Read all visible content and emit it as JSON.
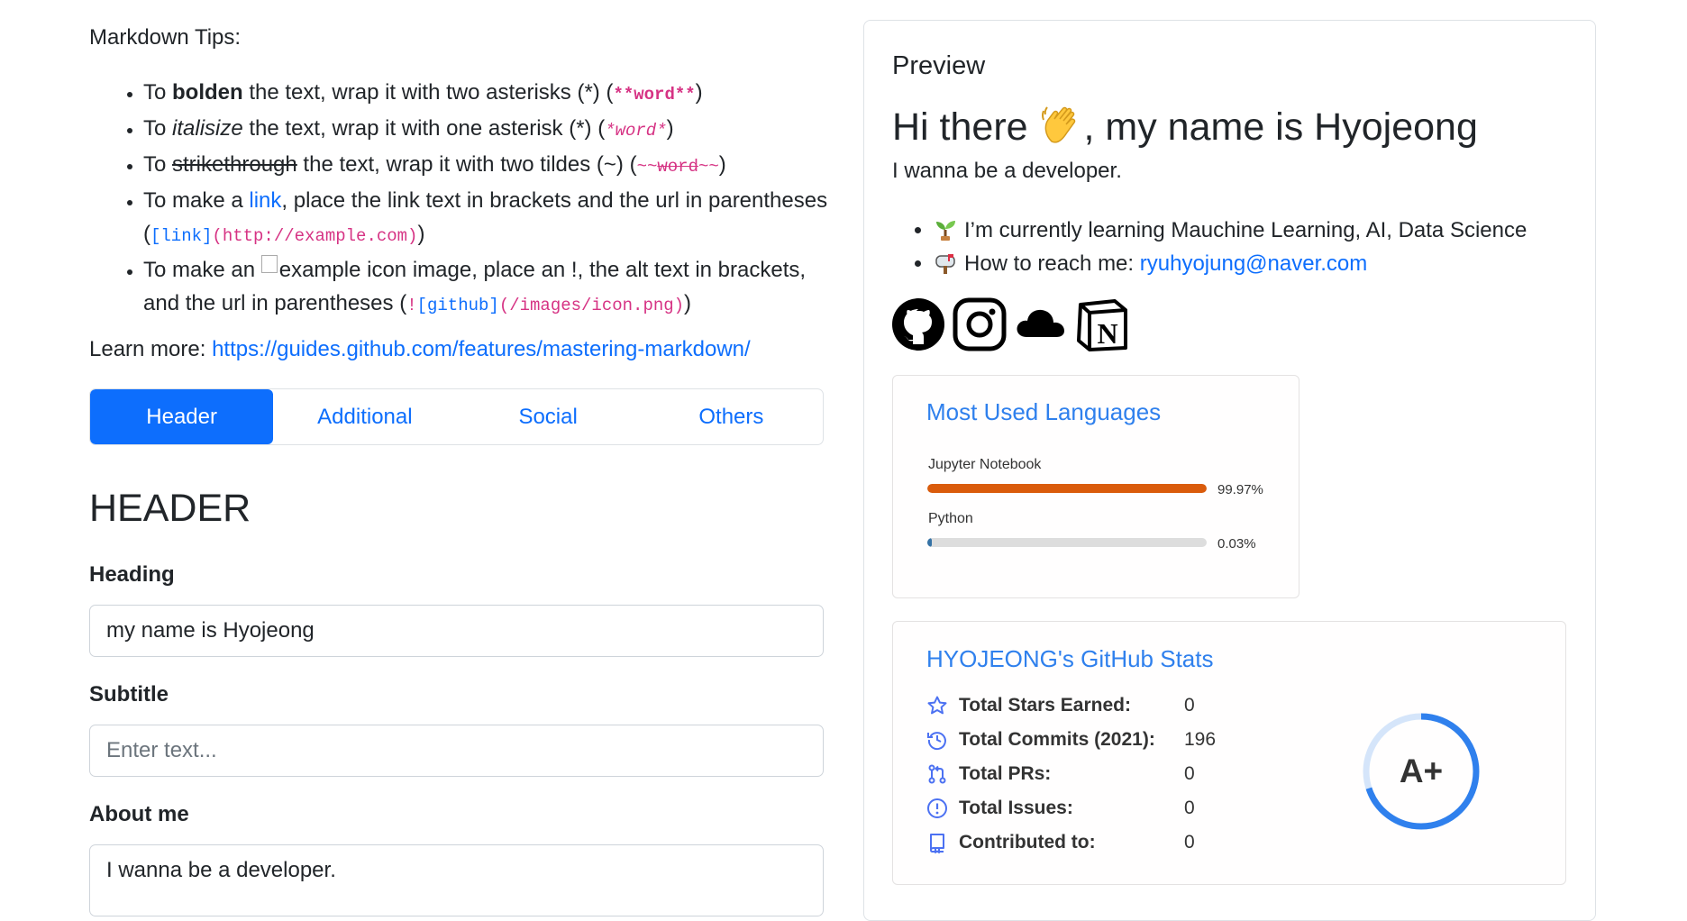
{
  "tips": {
    "title": "Markdown Tips:",
    "bold": {
      "pre": "To ",
      "word": "bolden",
      "post": " the text, wrap it with two asterisks (*) (",
      "code": "**word**",
      "end": ")"
    },
    "italic": {
      "pre": "To ",
      "word": "italisize",
      "post": " the text, wrap it with one asterisk (*) (",
      "code": "*word*",
      "end": ")"
    },
    "strike": {
      "pre": "To ",
      "word": "strikethrough",
      "post": " the text, wrap it with two tildes (~) (",
      "code_a": "~~",
      "code_b": "word",
      "code_c": "~~",
      "end": ")"
    },
    "link": {
      "pre": "To make a ",
      "word": "link",
      "post": ", place the link text in brackets and the url in parentheses (",
      "code_a": "[link]",
      "code_b": "(http://example.com)",
      "end": ")"
    },
    "image": {
      "pre": "To make an ",
      "alt": "example icon",
      "post": " image, place an !, the alt text in brackets, and the url in parentheses (",
      "code_a": "!",
      "code_b": "[github]",
      "code_c": "(/images/icon.png)",
      "end": ")"
    },
    "learn_label": "Learn more: ",
    "learn_url": "https://guides.github.com/features/mastering-markdown/"
  },
  "tabs": [
    {
      "label": "Header",
      "active": true
    },
    {
      "label": "Additional",
      "active": false
    },
    {
      "label": "Social",
      "active": false
    },
    {
      "label": "Others",
      "active": false
    }
  ],
  "section": {
    "title": "HEADER",
    "heading_label": "Heading",
    "heading_value": "my name is Hyojeong",
    "subtitle_label": "Subtitle",
    "subtitle_placeholder": "Enter text...",
    "about_label": "About me",
    "about_value": "I wanna be a developer."
  },
  "preview": {
    "title": "Preview",
    "h1_pre": "Hi there ",
    "h1_post": ", my name is Hyojeong",
    "subtitle": "I wanna be a developer.",
    "items": [
      {
        "icon": "seedling-icon",
        "text": "I’m currently learning Mauchine Learning, AI, Data Science"
      },
      {
        "icon": "mailbox-icon",
        "text": "How to reach me: ",
        "link": "ryuhyojung@naver.com"
      }
    ],
    "socials": [
      "github-icon",
      "instagram-icon",
      "cloud-icon",
      "notion-icon"
    ]
  },
  "languages_card": {
    "title": "Most Used Languages",
    "langs": [
      {
        "name": "Jupyter Notebook",
        "percent": 99.97,
        "label": "99.97%",
        "color": "#DA5B0B"
      },
      {
        "name": "Python",
        "percent": 0.03,
        "label": "0.03%",
        "color": "#3572A5"
      }
    ]
  },
  "stats_card": {
    "title": "HYOJEONG's GitHub Stats",
    "rows": [
      {
        "icon": "star-icon",
        "label": "Total Stars Earned:",
        "value": "0"
      },
      {
        "icon": "history-icon",
        "label": "Total Commits (2021):",
        "value": "196"
      },
      {
        "icon": "pull-request-icon",
        "label": "Total PRs:",
        "value": "0"
      },
      {
        "icon": "issue-icon",
        "label": "Total Issues:",
        "value": "0"
      },
      {
        "icon": "repo-icon",
        "label": "Contributed to:",
        "value": "0"
      }
    ],
    "rank": "A+",
    "rank_progress": 0.7,
    "accent": "#4c71f2",
    "ring_color": "#2f80ed"
  }
}
